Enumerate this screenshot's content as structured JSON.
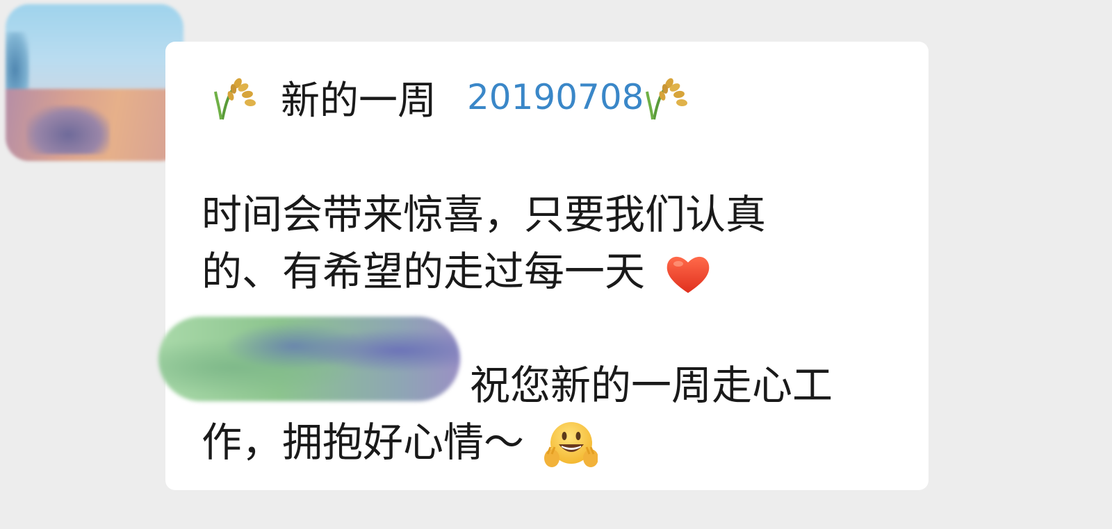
{
  "message": {
    "title": "新的一周",
    "date": "20190708",
    "line1": "时间会带来惊喜，只要我们认真",
    "line2": "的、有希望的走过每一天",
    "line3": "祝您新的一周走心工",
    "line4": "作，拥抱好心情～"
  },
  "icons": {
    "title_left": "rice-icon",
    "title_right": "rice-icon",
    "line2_end": "heart-icon",
    "line4_end": "smiley-hands-icon"
  },
  "colors": {
    "background": "#ededed",
    "bubble": "#ffffff",
    "date_text": "#3a87c8",
    "body_text": "#1a1a1a"
  }
}
